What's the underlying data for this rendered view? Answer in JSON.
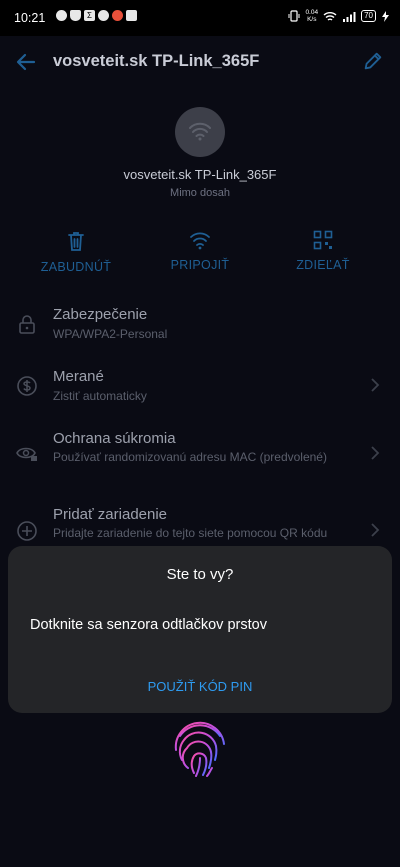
{
  "status_bar": {
    "time": "10:21",
    "net_speed_value": "0.04",
    "net_speed_unit": "K/s",
    "battery": "70"
  },
  "app_bar": {
    "title": "vosveteit.sk TP-Link_365F"
  },
  "network": {
    "name": "vosveteit.sk TP-Link_365F",
    "status": "Mimo dosah"
  },
  "actions": [
    {
      "label": "ZABUDNÚŤ",
      "icon": "trash-icon"
    },
    {
      "label": "PRIPOJIŤ",
      "icon": "wifi-icon"
    },
    {
      "label": "ZDIEĽAŤ",
      "icon": "qr-code-icon"
    }
  ],
  "settings": [
    {
      "title": "Zabezpečenie",
      "subtitle": "WPA/WPA2-Personal",
      "icon": "lock-icon"
    },
    {
      "title": "Merané",
      "subtitle": "Zistiť automaticky",
      "icon": "dollar-circle-icon"
    },
    {
      "title": "Ochrana súkromia",
      "subtitle": "Používať randomizovanú adresu MAC (predvolené)",
      "icon": "eye-lock-icon"
    },
    {
      "title": "Pridať zariadenie",
      "subtitle": "Pridajte zariadenie do tejto siete pomocou QR kódu",
      "icon": "add-circle-icon"
    }
  ],
  "dialog": {
    "title": "Ste to vy?",
    "message": "Dotknite sa senzora odtlačkov prstov",
    "button": "POUŽIŤ KÓD PIN"
  },
  "colors": {
    "background": "#0a0b14",
    "dialog": "#242528",
    "accent": "#2e9bf0",
    "action_dim": "#1f5f94"
  }
}
